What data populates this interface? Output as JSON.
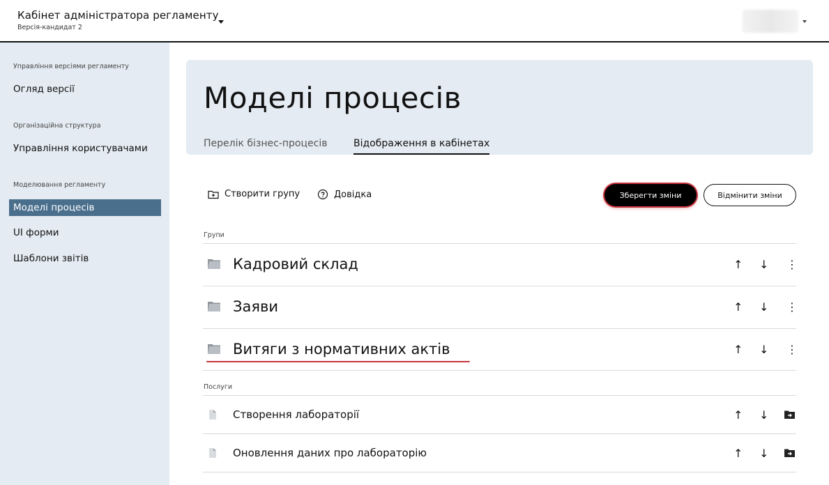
{
  "header": {
    "title": "Кабінет адміністратора регламенту",
    "subtitle": "Версія-кандидат 2"
  },
  "sidebar": {
    "sections": [
      {
        "caption": "Управління версіями регламенту",
        "items": [
          {
            "label": "Огляд версії"
          }
        ]
      },
      {
        "caption": "Організаційна структура",
        "items": [
          {
            "label": "Управління користувачами"
          }
        ]
      },
      {
        "caption": "Моделювання регламенту",
        "items": [
          {
            "label": "Моделі процесів",
            "active": true
          },
          {
            "label": "UI форми"
          },
          {
            "label": "Шаблони звітів"
          }
        ]
      }
    ]
  },
  "page": {
    "title": "Моделі процесів",
    "tabs": [
      {
        "label": "Перелік бізнес-процесів",
        "active": false
      },
      {
        "label": "Відображення в кабінетах",
        "active": true
      }
    ]
  },
  "toolbar": {
    "create_group": "Створити групу",
    "help": "Довідка",
    "save": "Зберегти зміни",
    "cancel": "Відмінити зміни"
  },
  "groups": {
    "caption": "Групи",
    "items": [
      {
        "label": "Кадровий склад",
        "icon": "folder-icon"
      },
      {
        "label": "Заяви",
        "icon": "folder-icon"
      },
      {
        "label": "Витяги з нормативних актів",
        "icon": "folder-icon",
        "highlighted": true
      }
    ]
  },
  "services": {
    "caption": "Послуги",
    "items": [
      {
        "label": "Створення лабораторії",
        "icon": "file-icon"
      },
      {
        "label": "Оновлення даних про лабораторію",
        "icon": "file-icon"
      }
    ]
  },
  "colors": {
    "sidebar_bg": "#e4ebf2",
    "active_item": "#4a6f8d",
    "highlight": "#c8343f"
  }
}
